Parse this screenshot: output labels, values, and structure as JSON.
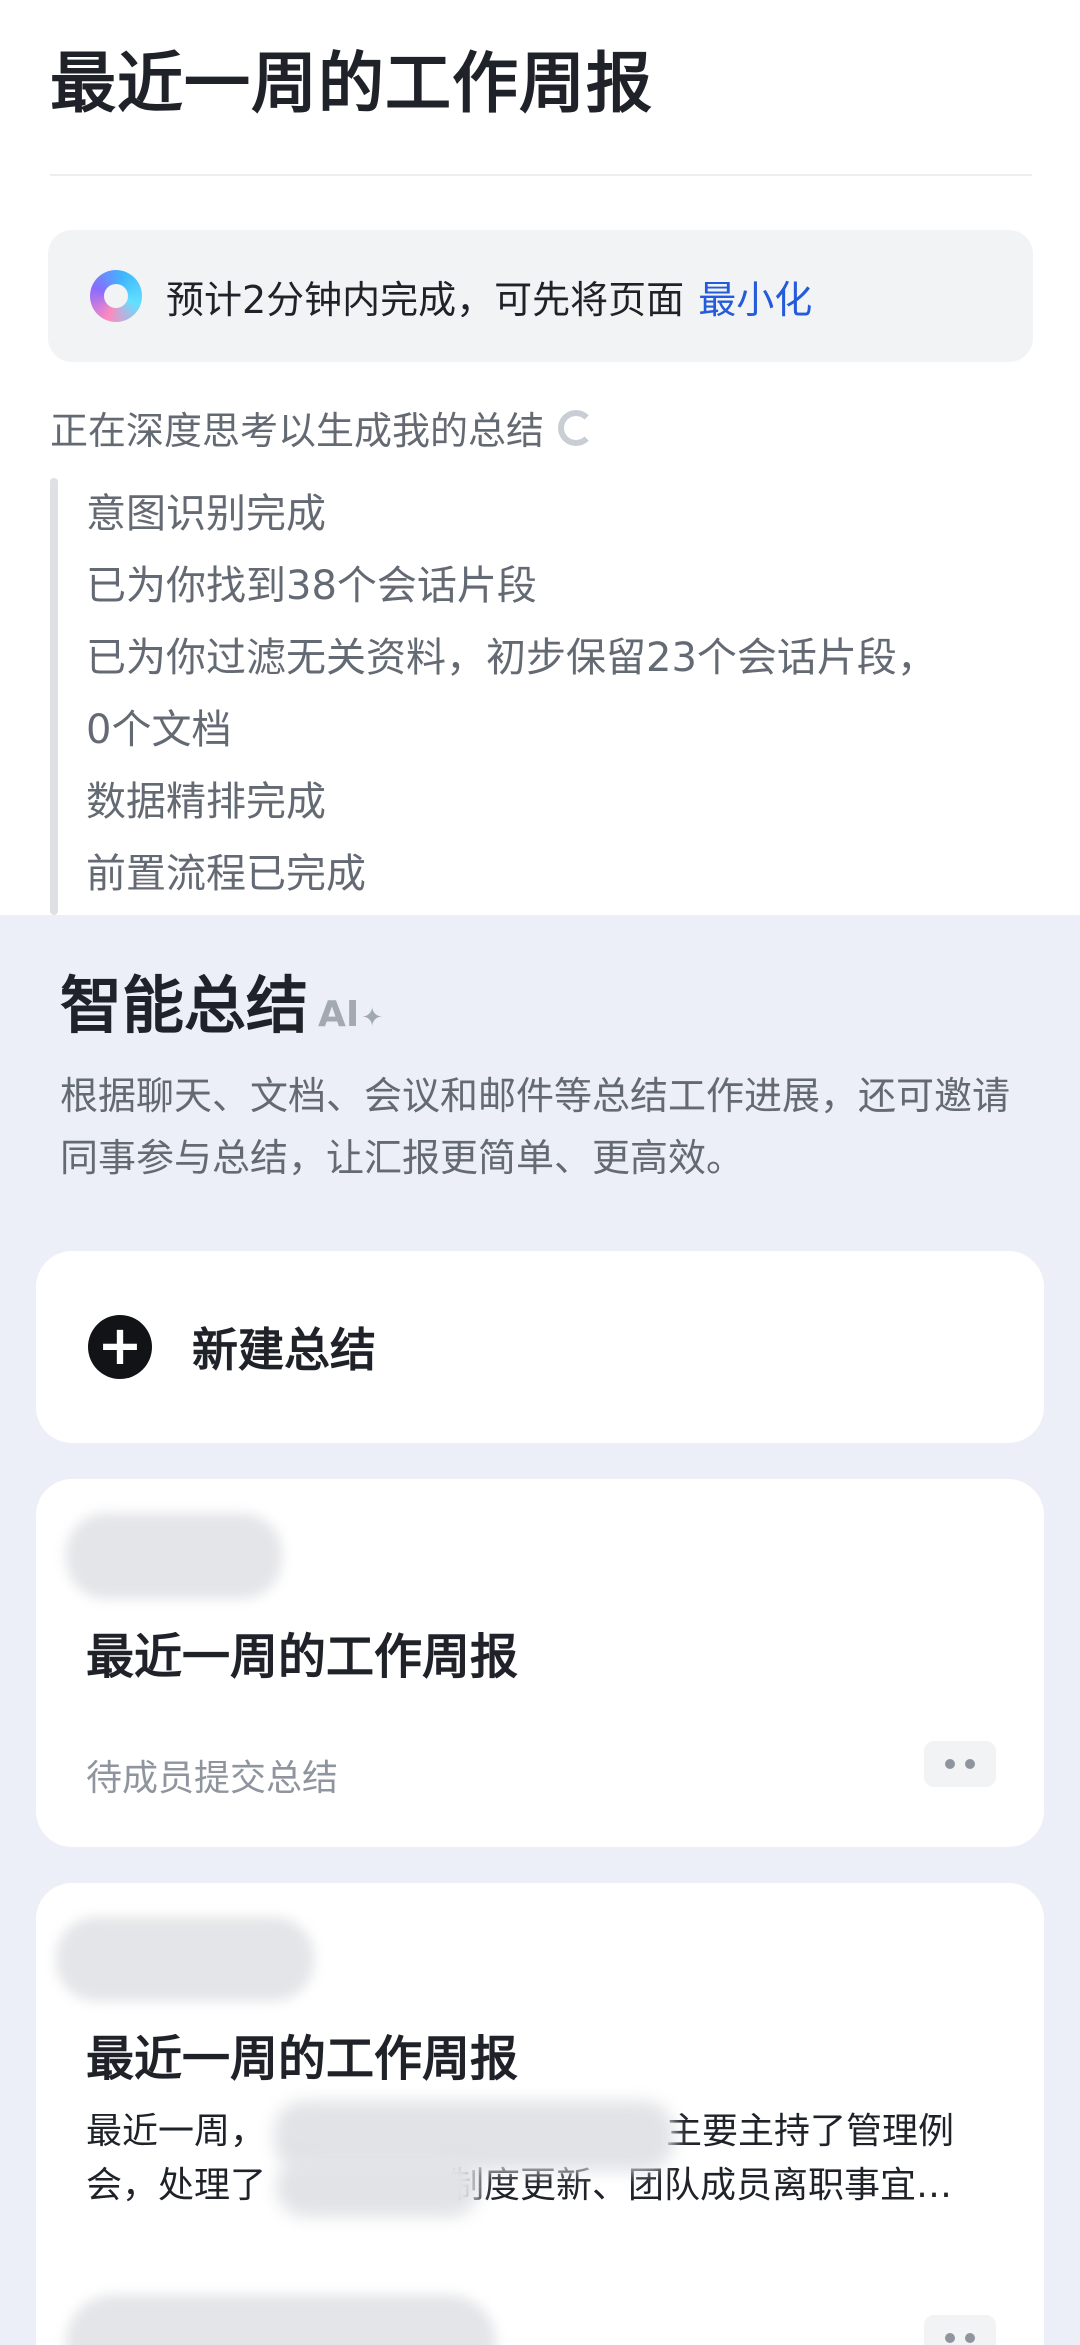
{
  "page_title": "最近一周的工作周报",
  "banner": {
    "text": "预计2分钟内完成，可先将页面",
    "link": "最小化"
  },
  "thinking": {
    "text": "正在深度思考以生成我的总结",
    "steps": [
      "意图识别完成",
      "已为你找到38个会话片段",
      "已为你过滤无关资料，初步保留23个会话片段，",
      "0个文档",
      "数据精排完成",
      "前置流程已完成"
    ]
  },
  "smart_summary": {
    "heading": "智能总结",
    "badge": "AI",
    "sparkle": "✦",
    "description": "根据聊天、文档、会议和邮件等总结工作进展，还可邀请同事参与总结，让汇报更简单、更高效。",
    "new_label": "新建总结",
    "plus": "+"
  },
  "cards": [
    {
      "title": "最近一周的工作周报",
      "status": "待成员提交总结"
    },
    {
      "title": "最近一周的工作周报",
      "snippet_line1_start": "最近一周，",
      "snippet_line1_end": "主要主持了管理例",
      "snippet_line2_start": "会，处理了",
      "snippet_line2_end": "制度更新、团队成员离职事宜…"
    }
  ]
}
